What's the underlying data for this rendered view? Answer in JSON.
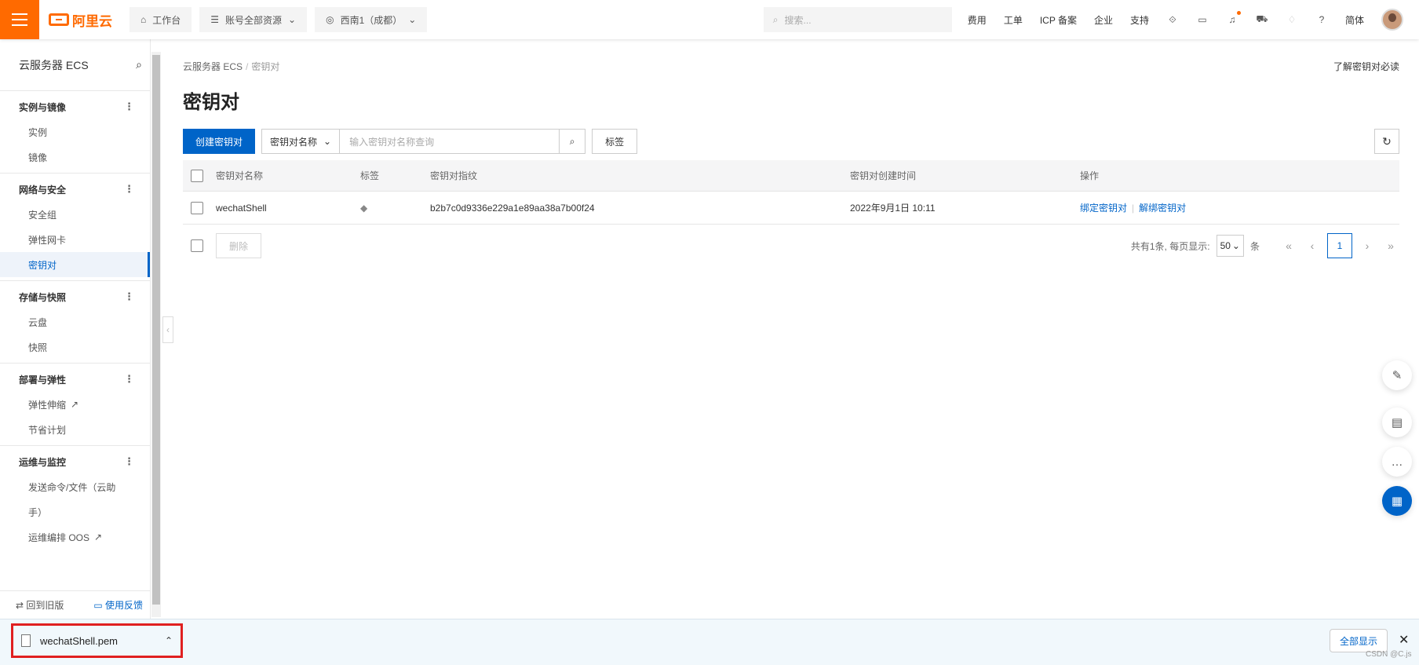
{
  "topbar": {
    "brand": "阿里云",
    "workbench": "工作台",
    "resource_scope": "账号全部资源",
    "region": "西南1（成都）",
    "search_placeholder": "搜索...",
    "links": [
      "费用",
      "工单",
      "ICP 备案",
      "企业",
      "支持"
    ],
    "language": "简体",
    "accent_color": "#ff6a00"
  },
  "sidebar": {
    "title": "云服务器 ECS",
    "groups": [
      {
        "label": "实例与镜像",
        "items": [
          "实例",
          "镜像"
        ]
      },
      {
        "label": "网络与安全",
        "items": [
          "安全组",
          "弹性网卡",
          "密钥对"
        ]
      },
      {
        "label": "存储与快照",
        "items": [
          "云盘",
          "快照"
        ]
      },
      {
        "label": "部署与弹性",
        "items": [
          "弹性伸缩",
          "节省计划"
        ]
      },
      {
        "label": "运维与监控",
        "items": [
          "发送命令/文件（云助",
          "手）",
          "运维编排 OOS"
        ]
      }
    ],
    "active_item": "密钥对",
    "footer_back": "回到旧版",
    "footer_feedback": "使用反馈"
  },
  "main": {
    "breadcrumb": [
      "云服务器 ECS",
      "密钥对"
    ],
    "help_link": "了解密钥对必读",
    "title": "密钥对",
    "create_button": "创建密钥对",
    "filter_select": "密钥对名称",
    "filter_placeholder": "输入密钥对名称查询",
    "tag_button": "标签",
    "columns": [
      "密钥对名称",
      "标签",
      "密钥对指纹",
      "密钥对创建时间",
      "操作"
    ],
    "rows": [
      {
        "name": "wechatShell",
        "fingerprint": "b2b7c0d9336e229a1e89aa38a7b00f24",
        "created": "2022年9月1日 10:11",
        "actions": [
          "绑定密钥对",
          "解绑密钥对"
        ]
      }
    ],
    "delete_button": "删除",
    "pager": {
      "summary": "共有1条, 每页显示:",
      "page_size": "50",
      "unit": "条",
      "current_page": "1"
    },
    "primary_color": "#0064c8"
  },
  "download_bar": {
    "file_name": "wechatShell.pem",
    "show_all": "全部显示",
    "watermark": "CSDN @C.js"
  }
}
